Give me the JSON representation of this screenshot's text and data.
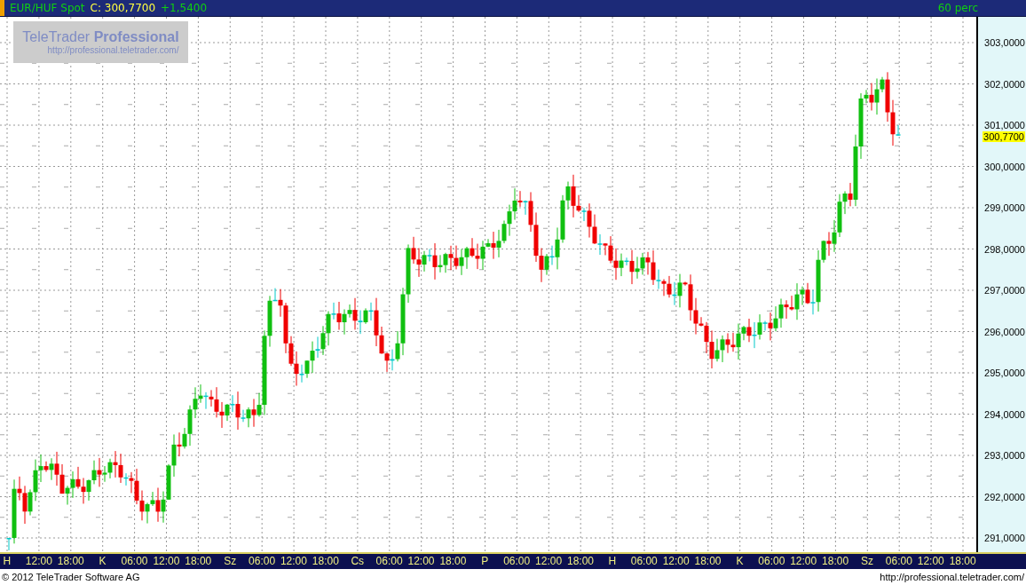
{
  "header": {
    "symbol": "EUR/HUF Spot",
    "close": "C: 300,7700",
    "change": "+1,5400",
    "interval": "60 perc"
  },
  "logo": {
    "name": "TeleTrader ",
    "name_bold": "Professional",
    "url": "http://professional.teletrader.com/"
  },
  "price_axis": {
    "labels": [
      "303,0000",
      "302,0000",
      "301,0000",
      "300,0000",
      "299,0000",
      "298,0000",
      "297,0000",
      "296,0000",
      "295,0000",
      "294,0000",
      "293,0000",
      "292,0000",
      "291,0000"
    ],
    "last_price": "300,7700"
  },
  "time_axis": [
    "H",
    "12:00",
    "18:00",
    "K",
    "06:00",
    "12:00",
    "18:00",
    "Sz",
    "06:00",
    "12:00",
    "18:00",
    "Cs",
    "06:00",
    "12:00",
    "18:00",
    "P",
    "06:00",
    "12:00",
    "18:00",
    "H",
    "06:00",
    "12:00",
    "18:00",
    "K",
    "06:00",
    "12:00",
    "18:00",
    "Sz",
    "06:00",
    "12:00",
    "18:00"
  ],
  "footer": {
    "copyright": "© 2012 TeleTrader Software AG",
    "url": "http://professional.teletrader.com/"
  }
}
